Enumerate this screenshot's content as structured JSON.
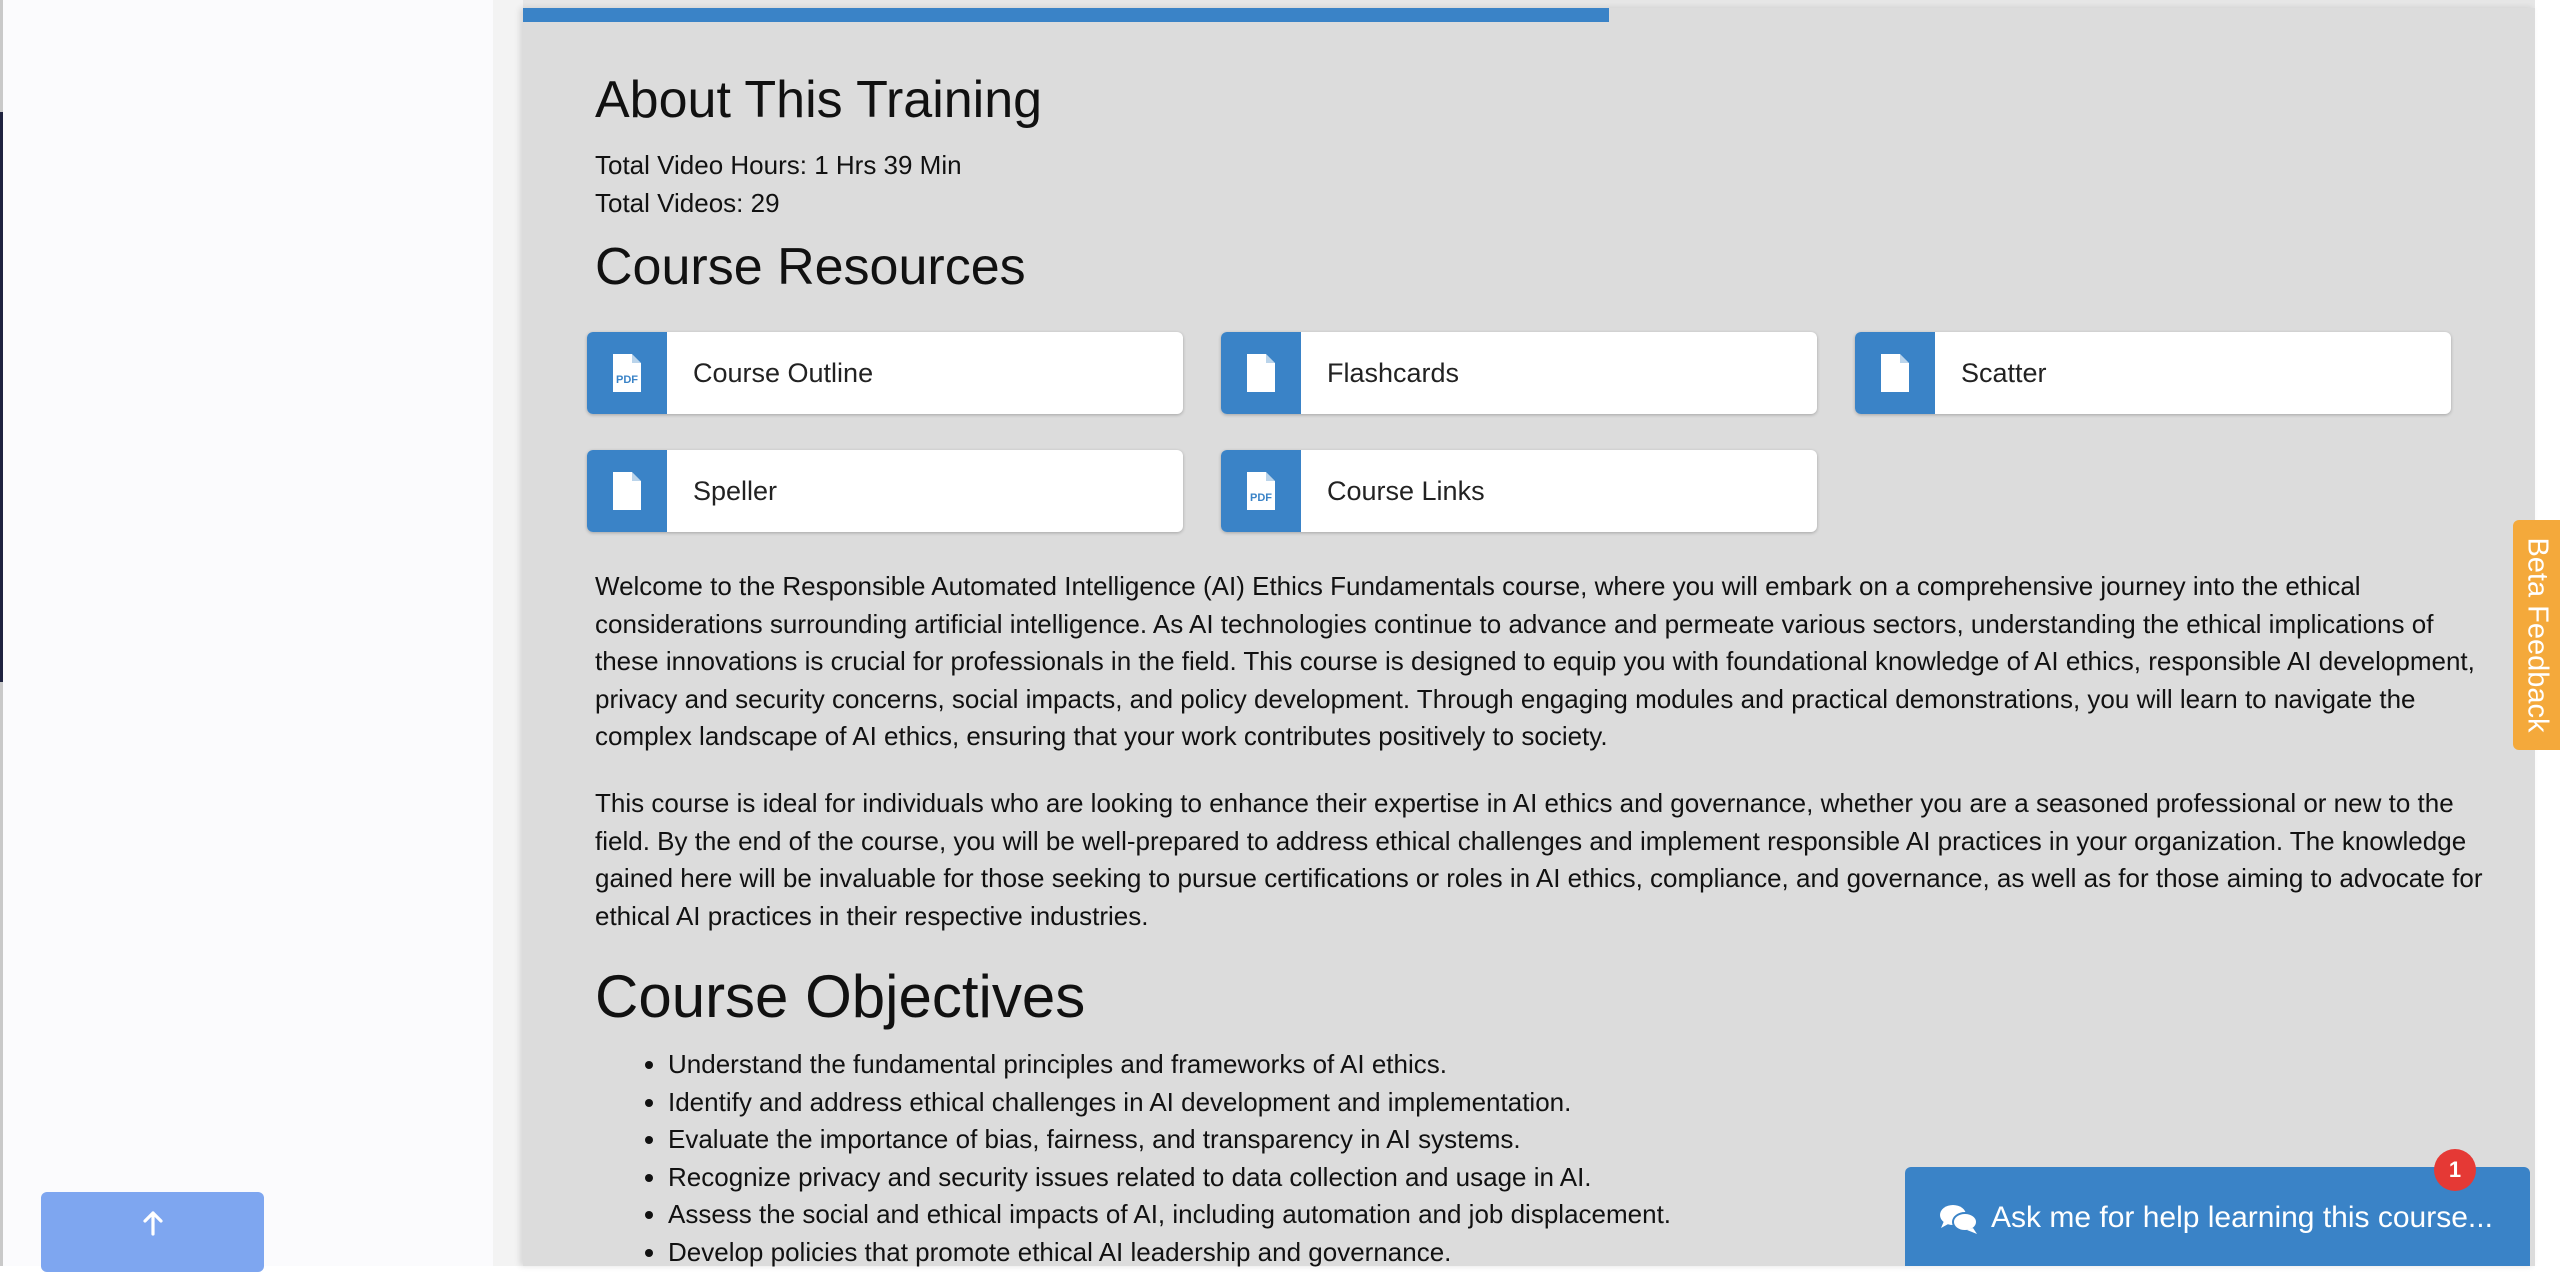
{
  "about": {
    "title": "About This Training",
    "total_video_hours": "Total Video Hours: 1 Hrs 39 Min",
    "total_videos": "Total Videos: 29"
  },
  "progress": {
    "fraction": 0.54,
    "color": "#3a83c7"
  },
  "resources": {
    "title": "Course Resources",
    "items": [
      {
        "label": "Course Outline",
        "icon": "pdf-file-icon"
      },
      {
        "label": "Flashcards",
        "icon": "file-icon"
      },
      {
        "label": "Scatter",
        "icon": "file-icon"
      },
      {
        "label": "Speller",
        "icon": "file-icon"
      },
      {
        "label": "Course Links",
        "icon": "pdf-file-icon"
      }
    ]
  },
  "description": {
    "paragraph_1": "Welcome to the Responsible Automated Intelligence (AI) Ethics Fundamentals course, where you will embark on a comprehensive journey into the ethical considerations surrounding artificial intelligence. As AI technologies continue to advance and permeate various sectors, understanding the ethical implications of these innovations is crucial for professionals in the field. This course is designed to equip you with foundational knowledge of AI ethics, responsible AI development, privacy and security concerns, social impacts, and policy development. Through engaging modules and practical demonstrations, you will learn to navigate the complex landscape of AI ethics, ensuring that your work contributes positively to society.",
    "paragraph_2": "This course is ideal for individuals who are looking to enhance their expertise in AI ethics and governance, whether you are a seasoned professional or new to the field. By the end of the course, you will be well-prepared to address ethical challenges and implement responsible AI practices in your organization. The knowledge gained here will be invaluable for those seeking to pursue certifications or roles in AI ethics, compliance, and governance, as well as for those aiming to advocate for ethical AI practices in their respective industries."
  },
  "objectives": {
    "title": "Course Objectives",
    "items": [
      "Understand the fundamental principles and frameworks of AI ethics.",
      "Identify and address ethical challenges in AI development and implementation.",
      "Evaluate the importance of bias, fairness, and transparency in AI systems.",
      "Recognize privacy and security issues related to data collection and usage in AI.",
      "Assess the social and ethical impacts of AI, including automation and job displacement.",
      "Develop policies that promote ethical AI leadership and governance."
    ]
  },
  "feedback": {
    "label": "Beta Feedback",
    "color": "#f4a93b"
  },
  "help": {
    "label": "Ask me for help learning this course...",
    "badge_count": "1",
    "icon": "chat-icon"
  },
  "scroll_top": {
    "icon": "arrow-up-icon"
  },
  "colors": {
    "accent": "#3a83c7",
    "panel_bg": "#dcdcdc",
    "badge": "#e53935"
  }
}
